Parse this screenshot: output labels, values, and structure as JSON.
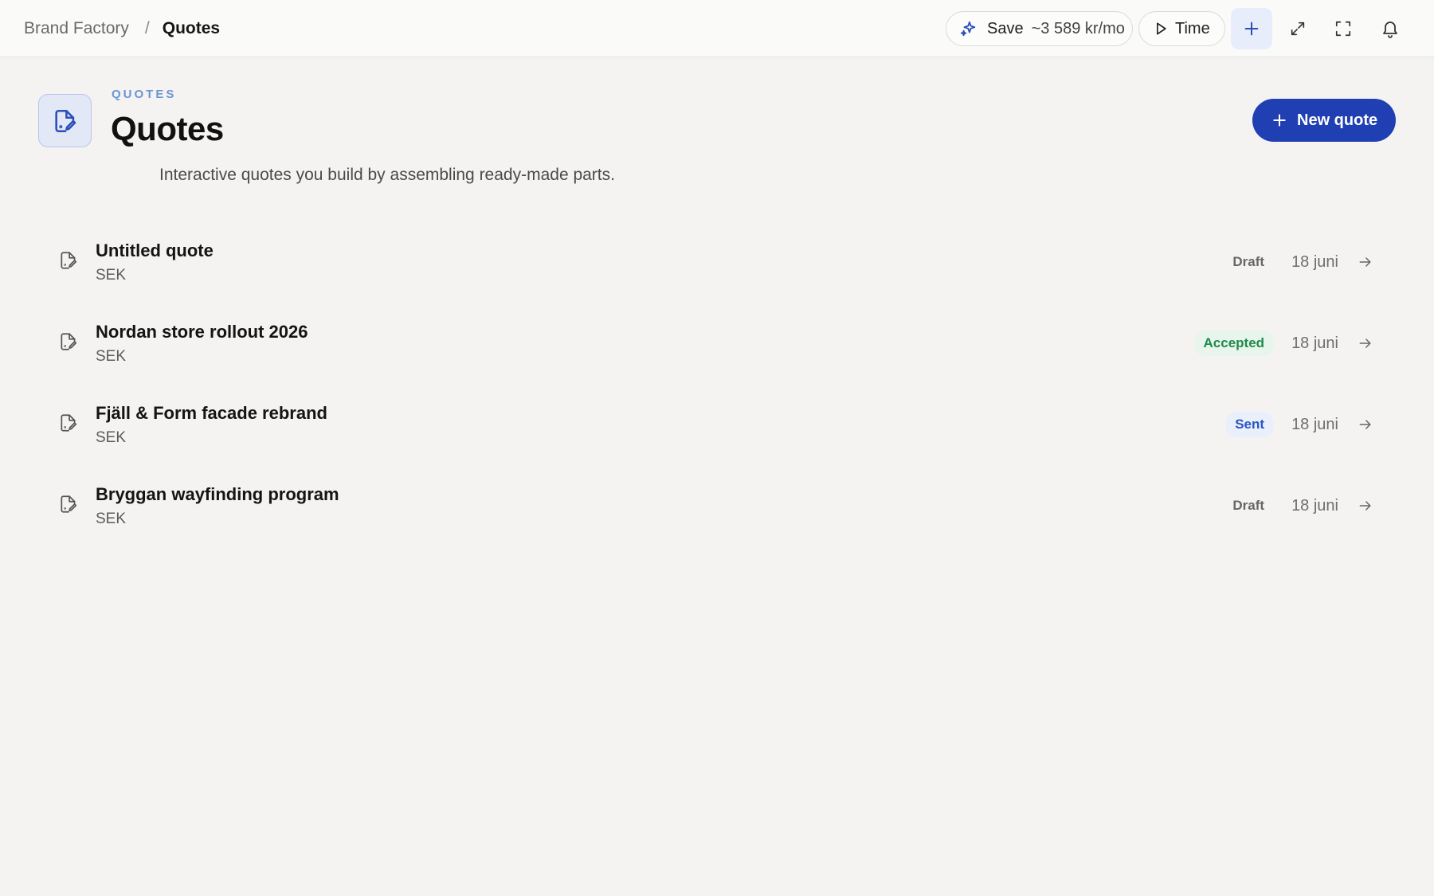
{
  "breadcrumb": {
    "root": "Brand Factory",
    "separator": "/",
    "current": "Quotes"
  },
  "toolbar": {
    "save_label": "Save",
    "save_amount": "~3 589 kr/mo",
    "time_label": "Time",
    "icons": [
      "sparkle-icon",
      "play-icon",
      "plus-icon",
      "expand-icon",
      "fullscreen-icon",
      "bell-icon"
    ]
  },
  "header": {
    "eyebrow": "QUOTES",
    "title": "Quotes",
    "subtitle": "Interactive quotes you build by assembling ready-made parts.",
    "new_button_label": "New quote",
    "accent_color": "#1f3fb2"
  },
  "quotes": [
    {
      "title": "Untitled quote",
      "currency": "SEK",
      "status": "Draft",
      "status_kind": "draft",
      "date": "18 juni"
    },
    {
      "title": "Nordan store rollout 2026",
      "currency": "SEK",
      "status": "Accepted",
      "status_kind": "accepted",
      "date": "18 juni"
    },
    {
      "title": "Fjäll & Form facade rebrand",
      "currency": "SEK",
      "status": "Sent",
      "status_kind": "sent",
      "date": "18 juni"
    },
    {
      "title": "Bryggan wayfinding program",
      "currency": "SEK",
      "status": "Draft",
      "status_kind": "draft",
      "date": "18 juni"
    }
  ],
  "status_colors": {
    "draft": "#666666",
    "accepted": "#1f8a4c",
    "sent": "#2a55c2"
  }
}
